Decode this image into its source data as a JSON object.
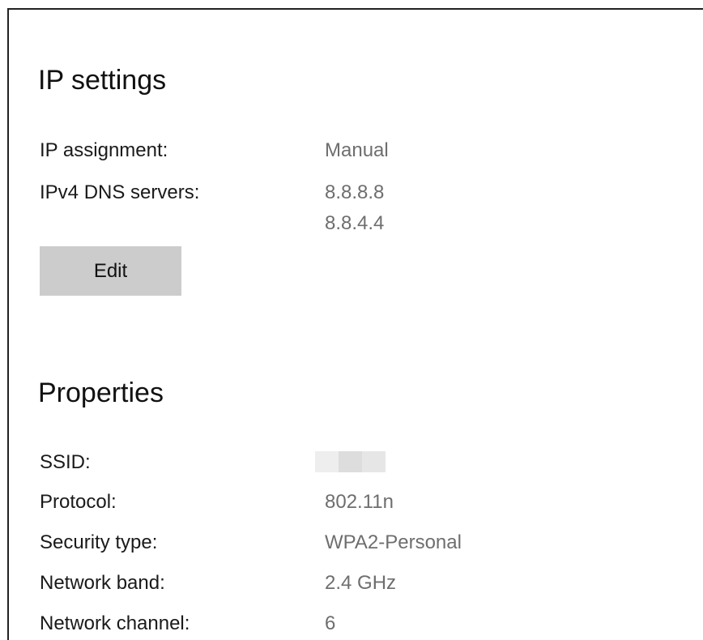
{
  "ip_settings": {
    "heading": "IP settings",
    "rows": [
      {
        "label": "IP assignment:",
        "value": "Manual"
      },
      {
        "label": "IPv4 DNS servers:",
        "values": [
          "8.8.8.8",
          "8.8.4.4"
        ]
      }
    ],
    "edit_label": "Edit"
  },
  "properties": {
    "heading": "Properties",
    "ssid_label": "SSID:",
    "ssid_redacted": true,
    "rows": [
      {
        "label": "Protocol:",
        "value": "802.11n"
      },
      {
        "label": "Security type:",
        "value": "WPA2-Personal"
      },
      {
        "label": "Network band:",
        "value": "2.4 GHz"
      },
      {
        "label": "Network channel:",
        "value": "6"
      }
    ]
  },
  "colors": {
    "background": "#ffffff",
    "label_text": "#1a1a1a",
    "value_text": "#6e6e6e",
    "button_bg": "#cccccc",
    "redaction": [
      "#eeeeee",
      "#dddddd",
      "#e6e6e6"
    ]
  }
}
